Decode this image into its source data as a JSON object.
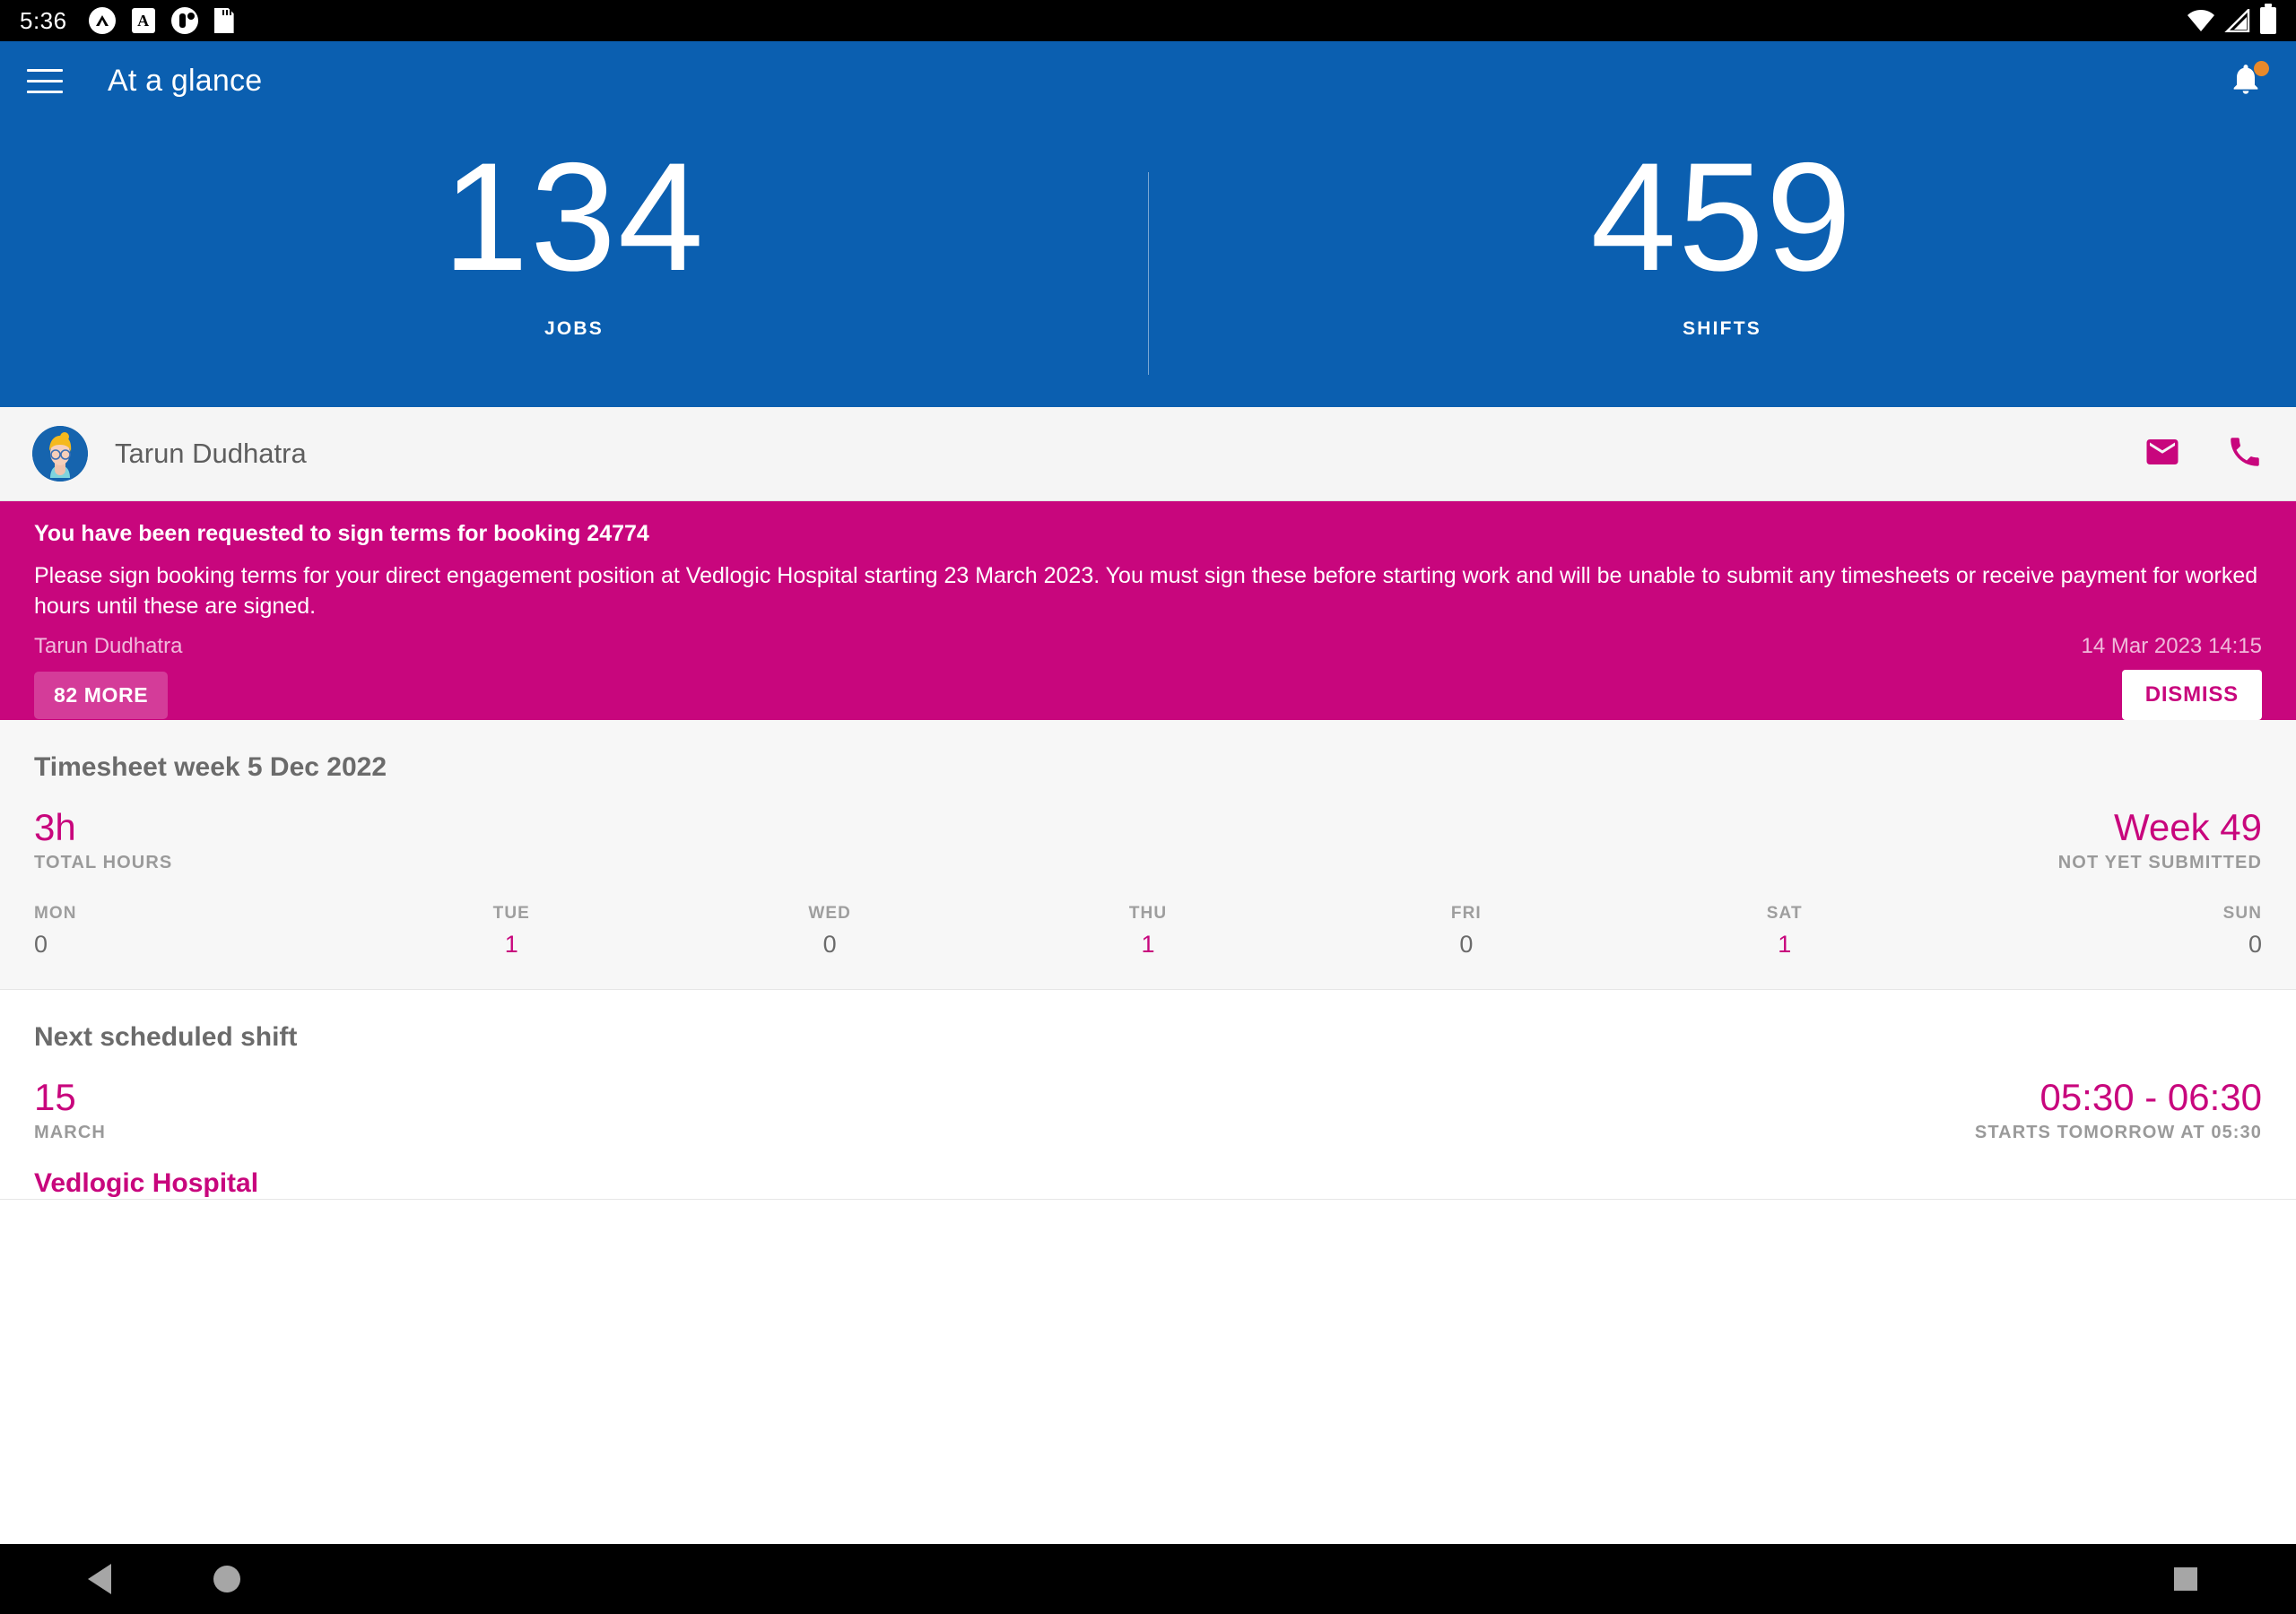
{
  "status_bar": {
    "clock": "5:36",
    "left_icons": [
      "chevron-app-icon",
      "font-app-icon",
      "person-app-icon",
      "sdcard-icon"
    ],
    "right_icons": [
      "wifi-icon",
      "cellular-signal-icon",
      "battery-icon"
    ]
  },
  "app_bar": {
    "menu_icon": "hamburger-menu-icon",
    "title": "At a glance",
    "notification_icon": "bell-icon",
    "notification_dot_color": "#e8892b",
    "background_color": "#0b5fb0"
  },
  "glance": {
    "items": [
      {
        "value": "134",
        "label": "JOBS"
      },
      {
        "value": "459",
        "label": "SHIFTS"
      }
    ]
  },
  "user": {
    "name": "Tarun Dudhatra",
    "avatar": "user-avatar",
    "actions": [
      {
        "name": "email-icon",
        "label": "Email"
      },
      {
        "name": "phone-icon",
        "label": "Call"
      }
    ],
    "accent_color": "#c8067d"
  },
  "banner": {
    "title": "You have been requested to sign terms for booking 24774",
    "body": "Please sign booking terms for your direct engagement position at Vedlogic Hospital starting 23 March 2023.  You must sign these before starting work and will be unable to submit any timesheets or receive payment for worked hours until these are signed.",
    "author": "Tarun Dudhatra",
    "timestamp": "14 Mar 2023 14:15",
    "more_label": "82 MORE",
    "dismiss_label": "DISMISS",
    "background_color": "#c8067d"
  },
  "timesheet": {
    "title": "Timesheet week 5 Dec 2022",
    "total_hours": "3h",
    "total_hours_label": "TOTAL HOURS",
    "week": "Week 49",
    "week_status": "NOT YET SUBMITTED",
    "days": [
      {
        "name": "MON",
        "value": "0"
      },
      {
        "name": "TUE",
        "value": "1"
      },
      {
        "name": "WED",
        "value": "0"
      },
      {
        "name": "THU",
        "value": "1"
      },
      {
        "name": "FRI",
        "value": "0"
      },
      {
        "name": "SAT",
        "value": "1"
      },
      {
        "name": "SUN",
        "value": "0"
      }
    ]
  },
  "next_shift": {
    "title": "Next scheduled shift",
    "day": "15",
    "month": "MARCH",
    "time_range": "05:30 - 06:30",
    "starts_note": "STARTS TOMORROW AT 05:30",
    "location": "Vedlogic Hospital"
  },
  "nav_bar": {
    "back_icon": "back-triangle-icon",
    "home_icon": "home-circle-icon",
    "recents_icon": "recents-square-icon"
  }
}
